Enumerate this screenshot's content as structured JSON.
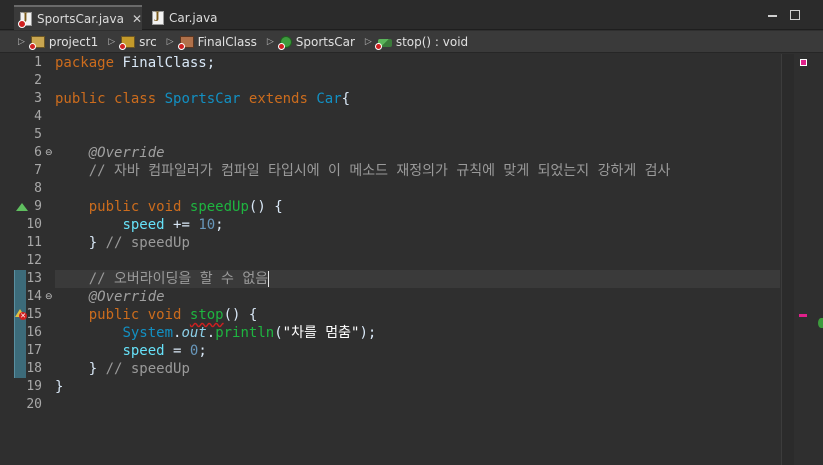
{
  "tabs": [
    {
      "label": "SportsCar.java",
      "active": true,
      "has_error": true,
      "close": "✕"
    },
    {
      "label": "Car.java",
      "active": false,
      "has_error": false
    }
  ],
  "window_controls": {
    "minimize_icon": "minimize-icon",
    "maximize_icon": "maximize-icon"
  },
  "breadcrumb": [
    {
      "label": "project1",
      "icon": "project-icon"
    },
    {
      "label": "src",
      "icon": "source-folder-icon"
    },
    {
      "label": "FinalClass",
      "icon": "package-icon"
    },
    {
      "label": "SportsCar",
      "icon": "class-icon"
    },
    {
      "label": "stop() : void",
      "icon": "method-icon"
    }
  ],
  "colors": {
    "background": "#2f2f2f",
    "keyword": "#cc6c1d",
    "type": "#1290c3",
    "comment": "#9a9a9a",
    "field": "#66e1f8",
    "method": "#1eb540",
    "error": "#d02020"
  },
  "editor": {
    "line_numbers": [
      "1",
      "2",
      "3",
      "4",
      "5",
      "6",
      "7",
      "8",
      "9",
      "10",
      "11",
      "12",
      "13",
      "14",
      "15",
      "16",
      "17",
      "18",
      "19",
      "20"
    ],
    "current_line": 13,
    "lines": {
      "l1": {
        "kw": "package",
        "rest": " FinalClass;"
      },
      "l3": {
        "kw1": "public",
        "kw2": "class",
        "name": "SportsCar",
        "kw3": "extends",
        "parent": "Car",
        "brace": "{"
      },
      "l6": {
        "ann": "@Override"
      },
      "l7": {
        "cmt": "// 자바 컴파일러가 컴파일 타입시에 이 메소드 재정의가 규칙에 맞게 되었는지 강하게 검사"
      },
      "l9": {
        "kw1": "public",
        "kw2": "void",
        "name": "speedUp",
        "rest": "() {"
      },
      "l10": {
        "field": "speed",
        "op": " += ",
        "num": "10",
        "end": ";"
      },
      "l11": {
        "brace": "}",
        "cmt": " // speedUp"
      },
      "l13": {
        "cmt": "// 오버라이딩을 할 수 없음"
      },
      "l14": {
        "ann": "@Override"
      },
      "l15": {
        "kw1": "public",
        "kw2": "void",
        "name": "stop",
        "rest": "() {"
      },
      "l16": {
        "type": "System",
        "dot1": ".",
        "stat": "out",
        "dot2": ".",
        "method": "println",
        "open": "(",
        "str": "\"차를 멈춤\"",
        "close": ");"
      },
      "l17": {
        "field": "speed",
        "op": " = ",
        "num": "0",
        "end": ";"
      },
      "l18": {
        "brace": "}",
        "cmt": " // speedUp"
      },
      "l19": {
        "brace": "}"
      }
    }
  }
}
